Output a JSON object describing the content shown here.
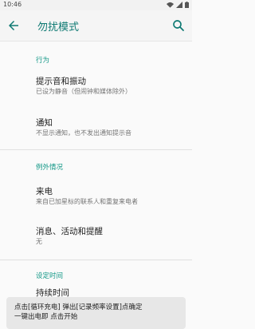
{
  "status": {
    "time": "10:46"
  },
  "appbar": {
    "title": "勿扰模式"
  },
  "sections": [
    {
      "title": "行为"
    },
    {
      "title": "例外情况"
    },
    {
      "title": "设定时间"
    }
  ],
  "items": [
    {
      "title": "提示音和振动",
      "subtitle": "已设为静音（但闹钟和媒体除外）"
    },
    {
      "title": "通知",
      "subtitle": "不显示通知，也不发出通知提示音"
    },
    {
      "title": "来电",
      "subtitle": "来自已加星标的联系人和重复来电者"
    },
    {
      "title": "消息、活动和提醒",
      "subtitle": "无"
    }
  ],
  "partial_item": "持续时间",
  "snackbar": {
    "line1": "点击[循环充电] 弹出[记录频率设置]点确定",
    "line2": "一键出电即  点击开始"
  },
  "colors": {
    "accent": "#119786",
    "title": "#0f7a73"
  }
}
